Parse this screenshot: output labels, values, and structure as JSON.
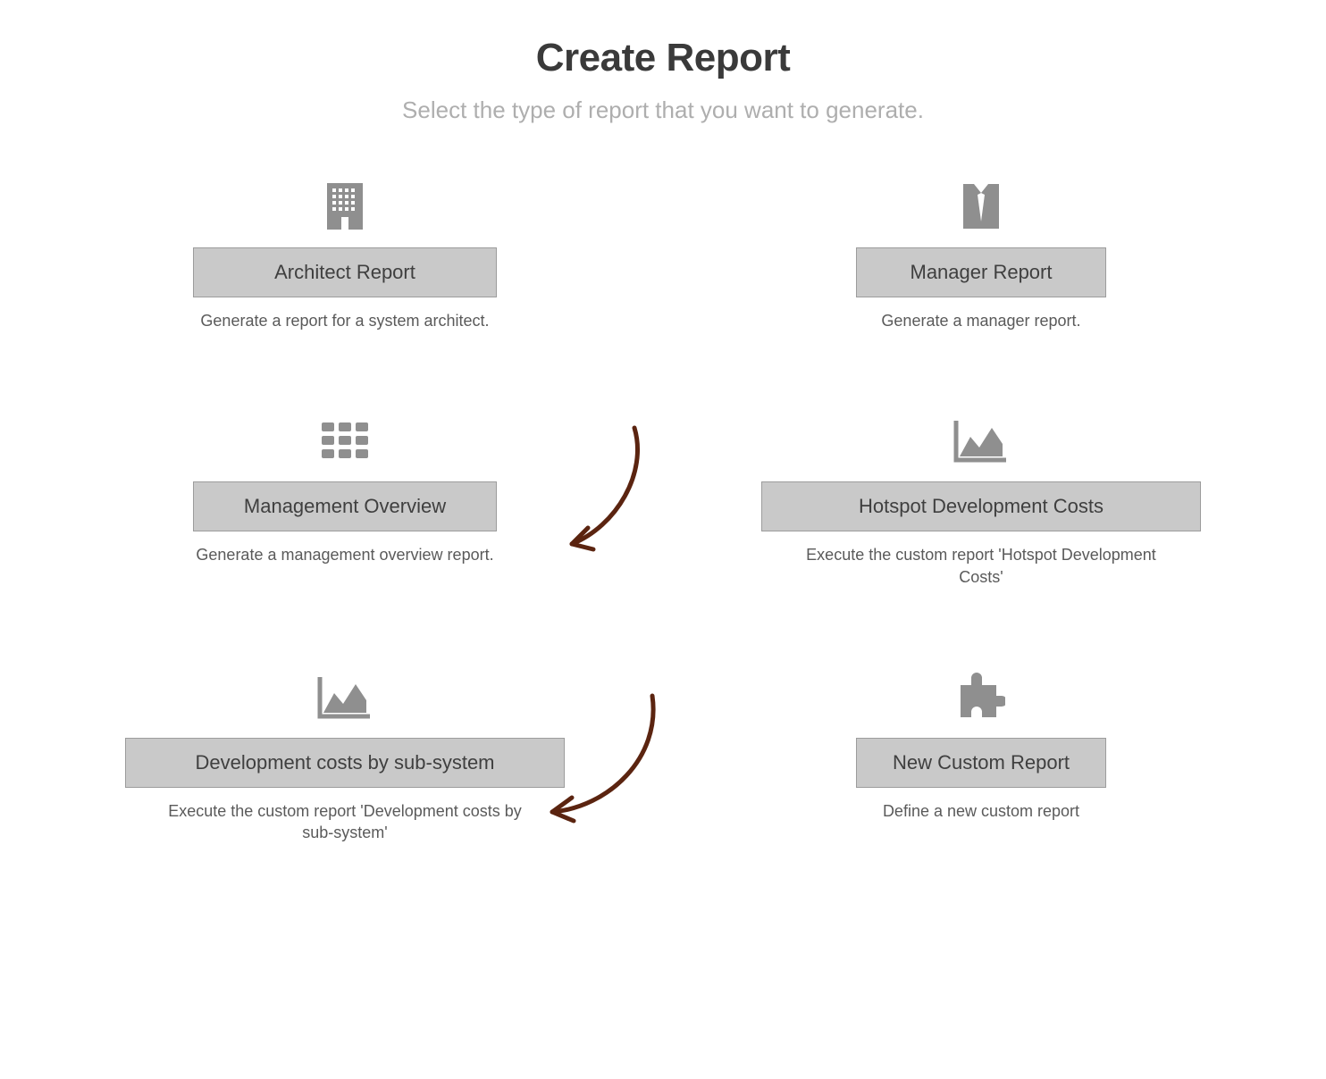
{
  "header": {
    "title": "Create Report",
    "subtitle": "Select the type of report that you want to generate."
  },
  "cards": [
    {
      "icon": "building-icon",
      "button_label": "Architect Report",
      "description": "Generate a report for a system architect."
    },
    {
      "icon": "tie-icon",
      "button_label": "Manager Report",
      "description": "Generate a manager report."
    },
    {
      "icon": "grid-icon",
      "button_label": "Management Overview",
      "description": "Generate a management overview report."
    },
    {
      "icon": "area-chart-icon",
      "button_label": "Hotspot Development Costs",
      "description": "Execute the custom report 'Hotspot Development Costs'"
    },
    {
      "icon": "area-chart-icon",
      "button_label": "Development costs by sub-system",
      "description": "Execute the custom report 'Development costs by sub-system'"
    },
    {
      "icon": "puzzle-icon",
      "button_label": "New Custom Report",
      "description": "Define a new custom report"
    }
  ]
}
